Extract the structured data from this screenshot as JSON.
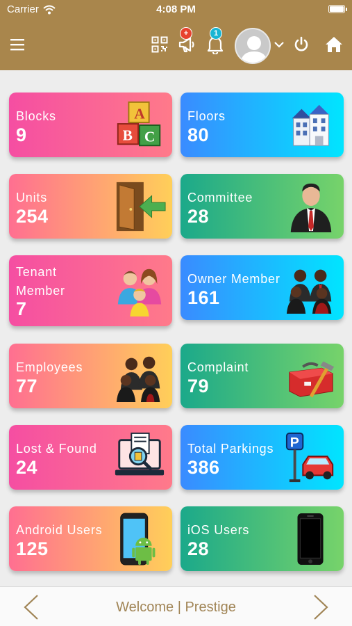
{
  "status": {
    "carrier": "Carrier",
    "time": "4:08 PM"
  },
  "nav": {
    "icons": [
      "hamburger-menu-icon",
      "qr-code-icon",
      "megaphone-icon",
      "bell-icon",
      "avatar",
      "chevron-down-icon",
      "power-icon",
      "home-icon"
    ],
    "megaphone_badge": "+",
    "notification_badge": "1",
    "colors": {
      "bar": "#a9864c",
      "badge_red": "#e8412e",
      "badge_cyan": "#19b5d3"
    }
  },
  "cards": [
    {
      "label": "Blocks",
      "value": "9",
      "icon": "abc-blocks-icon"
    },
    {
      "label": "Floors",
      "value": "80",
      "icon": "building-icon"
    },
    {
      "label": "Units",
      "value": "254",
      "icon": "door-enter-icon"
    },
    {
      "label": "Committee",
      "value": "28",
      "icon": "businessman-icon"
    },
    {
      "label": "Tenant Member",
      "value": "7",
      "icon": "family-icon"
    },
    {
      "label": "Owner Member",
      "value": "161",
      "icon": "group-people-icon"
    },
    {
      "label": "Employees",
      "value": "77",
      "icon": "employees-icon"
    },
    {
      "label": "Complaint",
      "value": "79",
      "icon": "toolbox-icon"
    },
    {
      "label": "Lost & Found",
      "value": "24",
      "icon": "search-laptop-icon"
    },
    {
      "label": "Total Parkings",
      "value": "386",
      "icon": "parking-car-icon"
    },
    {
      "label": "Android Users",
      "value": "125",
      "icon": "android-phone-icon"
    },
    {
      "label": "iOS Users",
      "value": "28",
      "icon": "iphone-icon"
    }
  ],
  "footer": {
    "title": "Welcome | Prestige"
  }
}
